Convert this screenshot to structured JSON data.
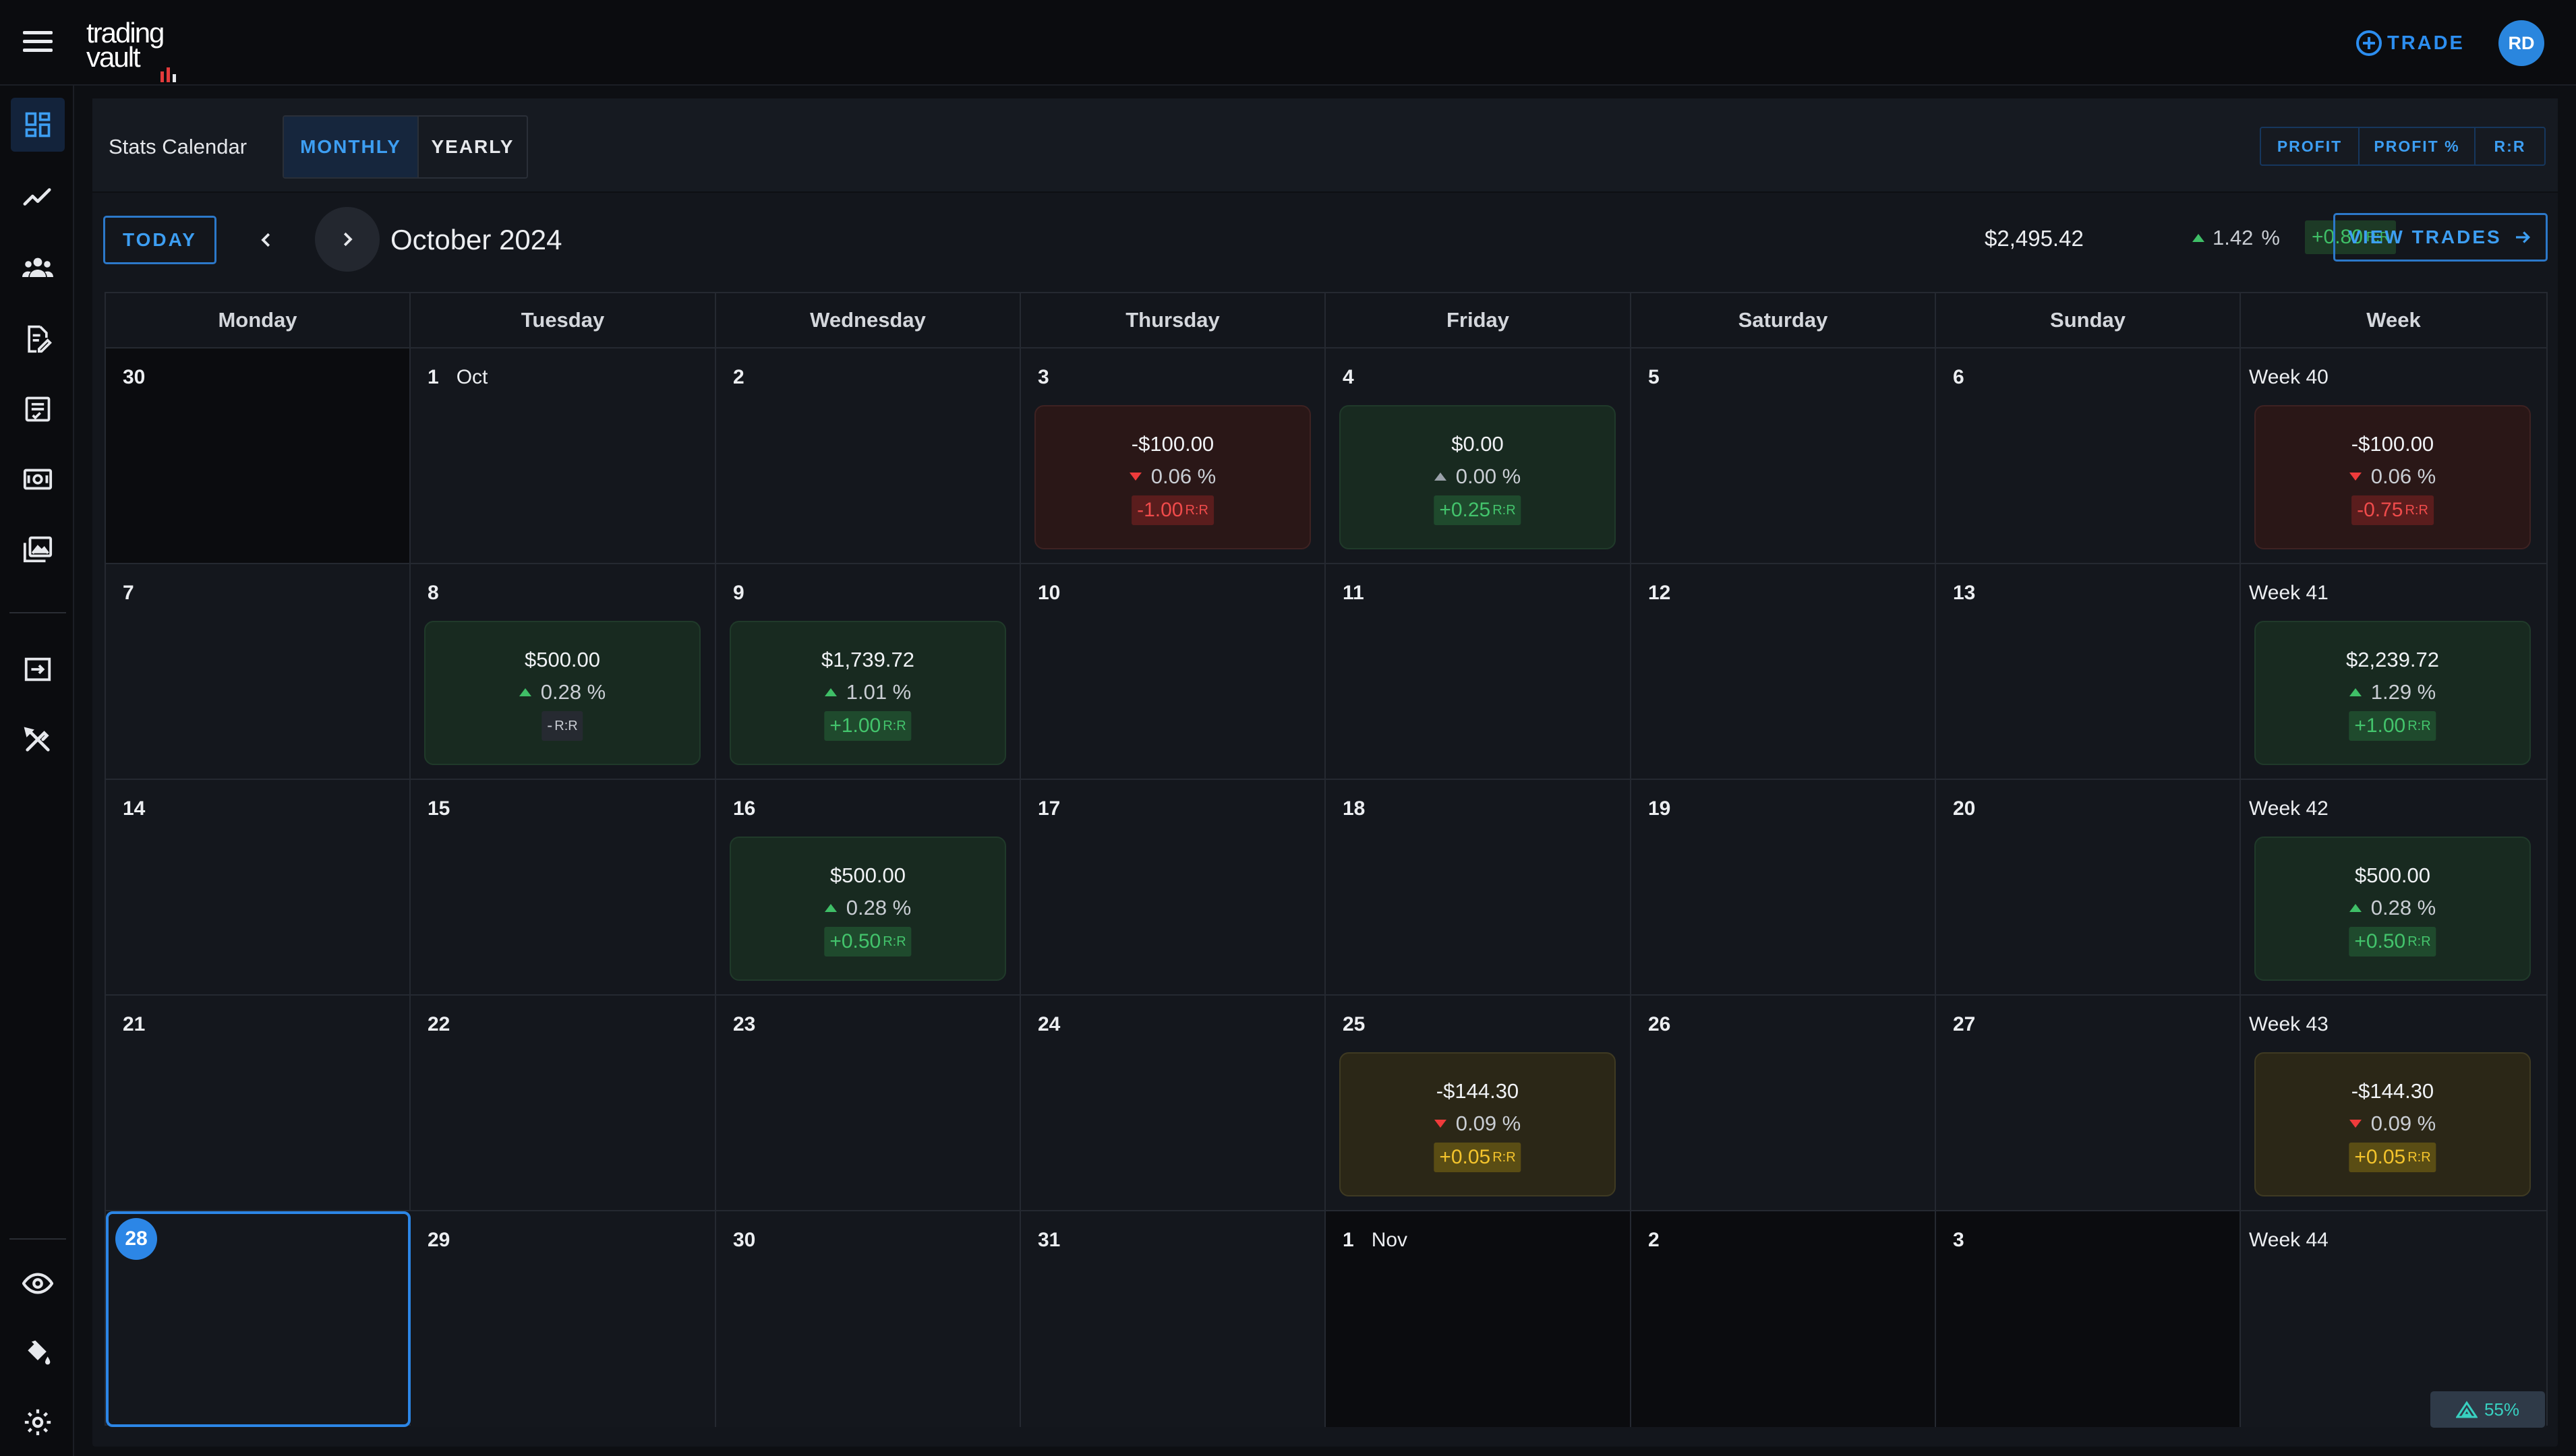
{
  "app": {
    "logo_line1": "trading",
    "logo_line2": "vault"
  },
  "header": {
    "trade_label": "TRADE",
    "avatar_initials": "RD"
  },
  "rail": {
    "items": [
      "dashboard-icon",
      "chart-line-icon",
      "users-icon",
      "journal-edit-icon",
      "checklist-icon",
      "money-icon",
      "gallery-icon",
      "import-icon",
      "tools-icon",
      "eye-icon",
      "paint-bucket-icon",
      "gear-icon"
    ],
    "active": "dashboard-icon"
  },
  "panel": {
    "title": "Stats Calendar",
    "view_tabs": [
      {
        "label": "MONTHLY",
        "active": true
      },
      {
        "label": "YEARLY",
        "active": false
      }
    ],
    "metric_tabs": [
      "PROFIT",
      "PROFIT %",
      "R:R"
    ]
  },
  "toolbar": {
    "today_label": "TODAY",
    "month_label": "October 2024",
    "summary_profit": "$2,495.42",
    "summary_pct": "1.42",
    "summary_pct_unit": "%",
    "summary_rr": "+0.80",
    "rr_unit": "R:R",
    "view_trades_label": "VIEW TRADES"
  },
  "calendar": {
    "headers": [
      "Monday",
      "Tuesday",
      "Wednesday",
      "Thursday",
      "Friday",
      "Saturday",
      "Sunday",
      "Week"
    ],
    "weeks": [
      {
        "days": [
          {
            "num": "30",
            "dim": true
          },
          {
            "num": "1",
            "month": "Oct"
          },
          {
            "num": "2"
          },
          {
            "num": "3",
            "stats": {
              "amount": "-$100.00",
              "pct": "0.06 %",
              "dir": "down",
              "rr": "-1.00",
              "tone": "loss"
            }
          },
          {
            "num": "4",
            "stats": {
              "amount": "$0.00",
              "pct": "0.00 %",
              "dir": "flat",
              "rr": "+0.25",
              "tone": "win"
            }
          },
          {
            "num": "5"
          },
          {
            "num": "6"
          }
        ],
        "week_label": "Week 40",
        "week_stats": {
          "amount": "-$100.00",
          "pct": "0.06 %",
          "dir": "down",
          "rr": "-0.75",
          "tone": "loss"
        }
      },
      {
        "days": [
          {
            "num": "7"
          },
          {
            "num": "8",
            "stats": {
              "amount": "$500.00",
              "pct": "0.28 %",
              "dir": "up",
              "rr": "-",
              "tone": "win",
              "rr_tone": "none"
            }
          },
          {
            "num": "9",
            "stats": {
              "amount": "$1,739.72",
              "pct": "1.01 %",
              "dir": "up",
              "rr": "+1.00",
              "tone": "win"
            }
          },
          {
            "num": "10"
          },
          {
            "num": "11"
          },
          {
            "num": "12"
          },
          {
            "num": "13"
          }
        ],
        "week_label": "Week 41",
        "week_stats": {
          "amount": "$2,239.72",
          "pct": "1.29 %",
          "dir": "up",
          "rr": "+1.00",
          "tone": "win"
        }
      },
      {
        "days": [
          {
            "num": "14"
          },
          {
            "num": "15"
          },
          {
            "num": "16",
            "stats": {
              "amount": "$500.00",
              "pct": "0.28 %",
              "dir": "up",
              "rr": "+0.50",
              "tone": "win"
            }
          },
          {
            "num": "17"
          },
          {
            "num": "18"
          },
          {
            "num": "19"
          },
          {
            "num": "20"
          }
        ],
        "week_label": "Week 42",
        "week_stats": {
          "amount": "$500.00",
          "pct": "0.28 %",
          "dir": "up",
          "rr": "+0.50",
          "tone": "win"
        }
      },
      {
        "days": [
          {
            "num": "21"
          },
          {
            "num": "22"
          },
          {
            "num": "23"
          },
          {
            "num": "24"
          },
          {
            "num": "25",
            "stats": {
              "amount": "-$144.30",
              "pct": "0.09 %",
              "dir": "down",
              "rr": "+0.05",
              "tone": "warn"
            }
          },
          {
            "num": "26"
          },
          {
            "num": "27"
          }
        ],
        "week_label": "Week 43",
        "week_stats": {
          "amount": "-$144.30",
          "pct": "0.09 %",
          "dir": "down",
          "rr": "+0.05",
          "tone": "warn"
        }
      },
      {
        "days": [
          {
            "num": "28",
            "today": true
          },
          {
            "num": "29"
          },
          {
            "num": "30"
          },
          {
            "num": "31"
          },
          {
            "num": "1",
            "month": "Nov",
            "dim": true
          },
          {
            "num": "2",
            "dim": true
          },
          {
            "num": "3",
            "dim": true
          }
        ],
        "week_label": "Week 44"
      }
    ]
  },
  "zoom": {
    "value": "55%"
  },
  "colors": {
    "accent": "#2c8ef0",
    "profit": "#3fbf67",
    "loss": "#ef3b3b",
    "warn": "#f4c42c"
  }
}
